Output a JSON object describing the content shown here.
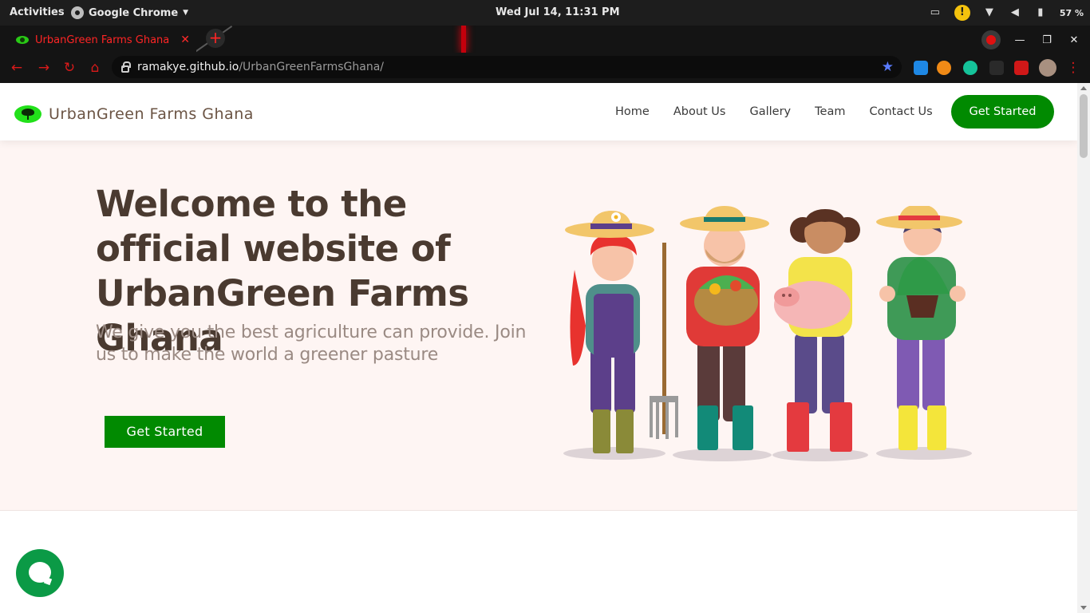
{
  "os": {
    "activities": "Activities",
    "app_name": "Google Chrome",
    "clock": "Wed Jul 14, 11:31 PM",
    "battery": "57 %"
  },
  "browser": {
    "tab_title": "UrbanGreen Farms Ghana",
    "url_host": "ramakye.github.io",
    "url_path": "/UrbanGreenFarmsGhana/"
  },
  "site": {
    "brand": "UrbanGreen Farms Ghana",
    "nav": [
      "Home",
      "About Us",
      "Gallery",
      "Team",
      "Contact Us"
    ],
    "header_cta": "Get Started",
    "hero": {
      "title": "Welcome to the official website of UrbanGreen Farms Ghana",
      "subtitle": "We give you the best agriculture can provide. Join us to make the world a greener pasture",
      "cta": "Get Started"
    }
  },
  "colors": {
    "brand_green": "#018a01",
    "hero_bg": "#fef5f3",
    "heading": "#4a3a30",
    "chrome_accent": "#ff2525"
  }
}
